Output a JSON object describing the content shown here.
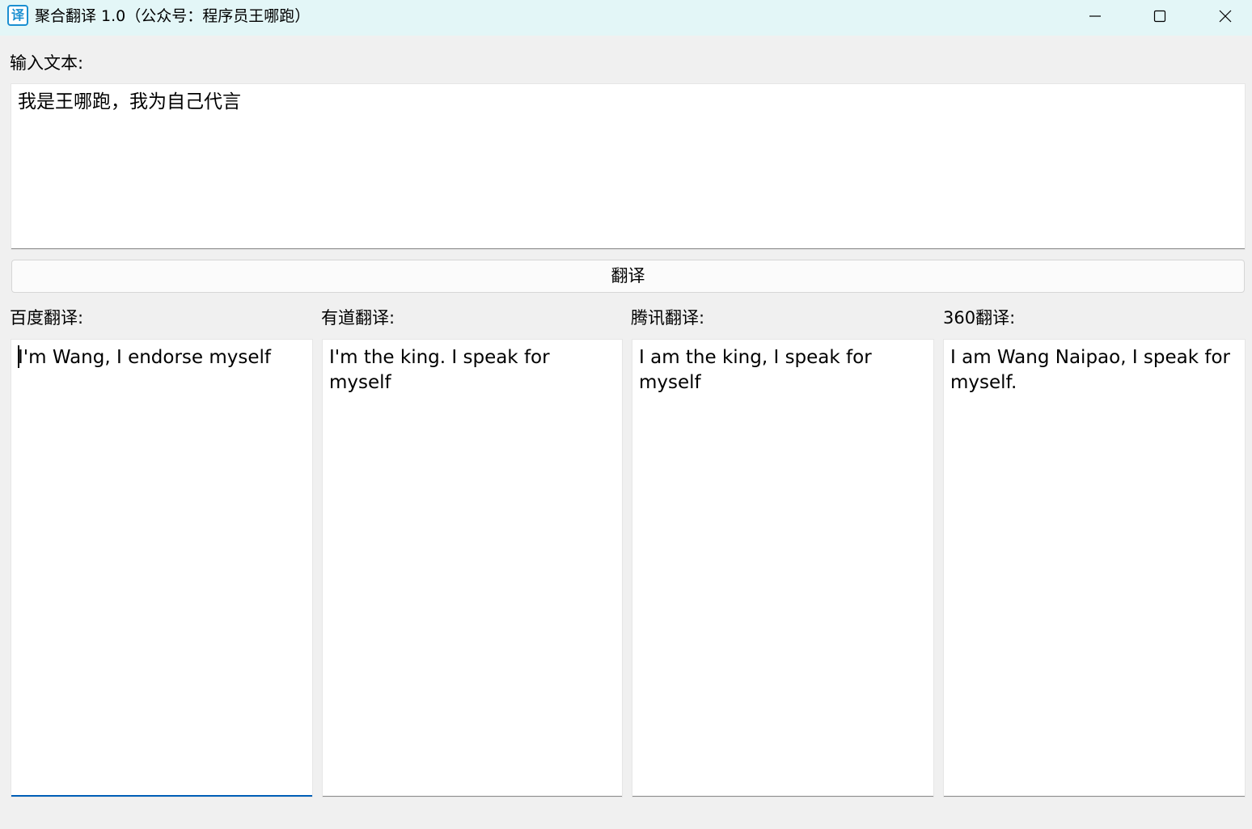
{
  "window": {
    "icon_glyph": "译",
    "icon_name": "translate-app-icon",
    "title": "聚合翻译 1.0（公众号：程序员王哪跑）",
    "controls": [
      "minimize-icon",
      "maximize-icon",
      "close-icon"
    ]
  },
  "input": {
    "label": "输入文本:",
    "value": "我是王哪跑，我为自己代言"
  },
  "translate_button": {
    "label": "翻译"
  },
  "results": [
    {
      "label": "百度翻译:",
      "value": "I'm Wang, I endorse myself"
    },
    {
      "label": "有道翻译:",
      "value": "I'm the king. I speak for myself"
    },
    {
      "label": "腾讯翻译:",
      "value": "I am the king, I speak for myself"
    },
    {
      "label": "360翻译:",
      "value": "I am Wang Naipao, I speak for myself."
    }
  ],
  "colors": {
    "titlebar": "#e3f6f7",
    "window_bg": "#f0f0f0",
    "focus_accent": "#005fb8",
    "icon_accent": "#1b8fd1"
  }
}
